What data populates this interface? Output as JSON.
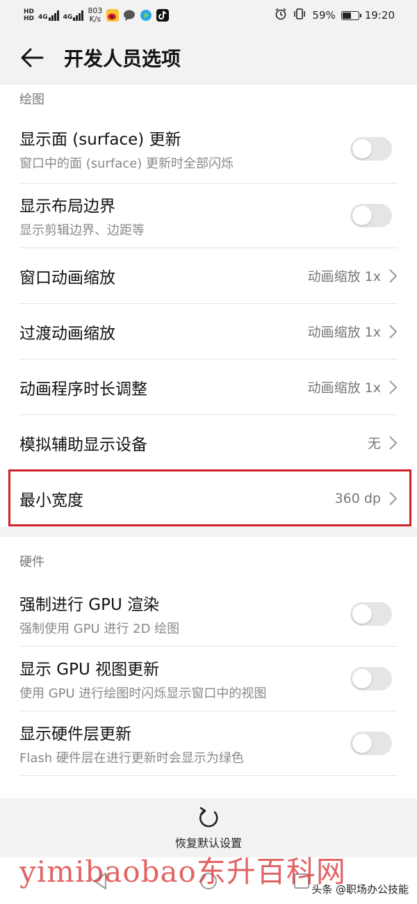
{
  "status_bar": {
    "hd_top": "HD",
    "hd_bottom": "HD",
    "sim1": "4G",
    "sim2": "4G",
    "speed_value": "803",
    "speed_unit": "K/s",
    "battery": "59%",
    "battery_level": 0.59,
    "time": "19:20",
    "app_icons": [
      "weibo-icon",
      "chat-icon",
      "video-icon",
      "tiktok-icon"
    ]
  },
  "header": {
    "title": "开发人员选项"
  },
  "drawing": {
    "label": "绘图",
    "items": [
      {
        "title": "显示面 (surface) 更新",
        "subtitle": "窗口中的面 (surface) 更新时全部闪烁",
        "type": "toggle",
        "on": false
      },
      {
        "title": "显示布局边界",
        "subtitle": "显示剪辑边界、边距等",
        "type": "toggle",
        "on": false
      },
      {
        "title": "窗口动画缩放",
        "value": "动画缩放 1x",
        "type": "nav"
      },
      {
        "title": "过渡动画缩放",
        "value": "动画缩放 1x",
        "type": "nav"
      },
      {
        "title": "动画程序时长调整",
        "value": "动画缩放 1x",
        "type": "nav"
      },
      {
        "title": "模拟辅助显示设备",
        "value": "无",
        "type": "nav"
      },
      {
        "title": "最小宽度",
        "value": "360 dp",
        "type": "nav"
      }
    ]
  },
  "hardware": {
    "label": "硬件",
    "items": [
      {
        "title": "强制进行 GPU 渲染",
        "subtitle": "强制使用 GPU 进行 2D 绘图",
        "type": "toggle",
        "on": false
      },
      {
        "title": "显示 GPU 视图更新",
        "subtitle": "使用 GPU 进行绘图时闪烁显示窗口中的视图",
        "type": "toggle",
        "on": false
      },
      {
        "title": "显示硬件层更新",
        "subtitle": "Flash 硬件层在进行更新时会显示为绿色",
        "type": "toggle",
        "on": false
      }
    ]
  },
  "footer": {
    "reset_label": "恢复默认设置"
  },
  "watermark": "yimibaobao东升百科网",
  "credit": "头条 @职场办公技能",
  "colors": {
    "background": "#f2f2f2",
    "card": "#ffffff",
    "highlight": "#d0202a",
    "toggle_off": "#e5e5e5"
  }
}
